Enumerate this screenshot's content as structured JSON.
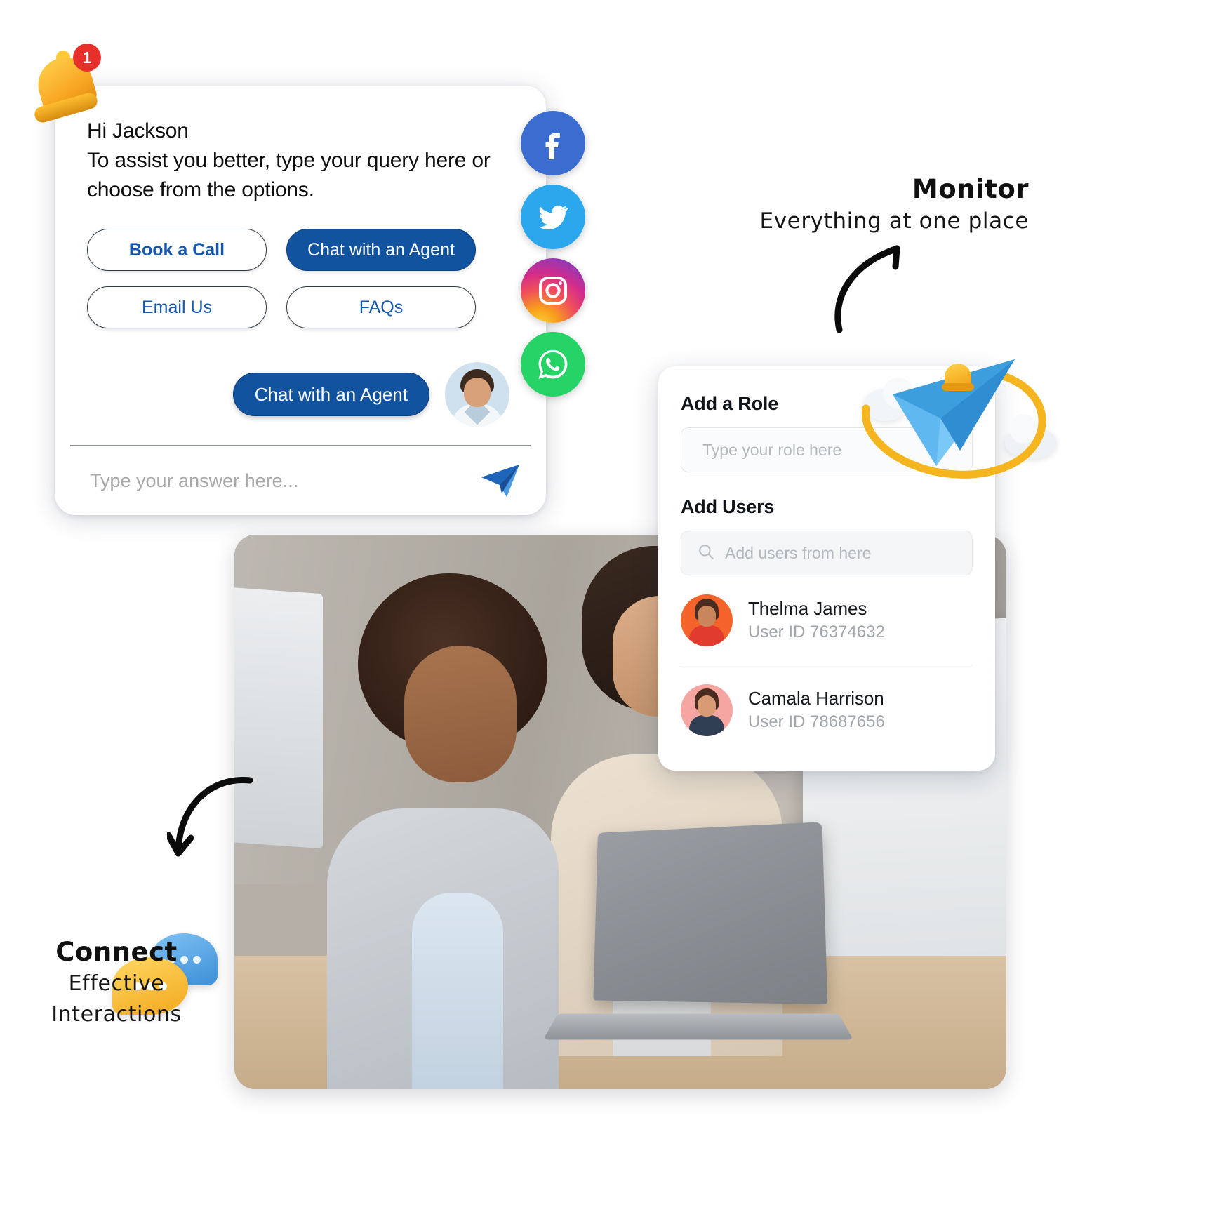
{
  "chat_widget": {
    "notification": {
      "icon": "bell-icon",
      "badge_count": "1"
    },
    "greeting": "Hi Jackson",
    "message_line1": "To assist you better, type your query here or",
    "message_line2": "choose from the options.",
    "options": [
      {
        "label": "Book a Call",
        "style": "outline"
      },
      {
        "label": "Chat with an Agent",
        "style": "filled"
      },
      {
        "label": "Email Us",
        "style": "outline"
      },
      {
        "label": "FAQs",
        "style": "outline"
      }
    ],
    "agent_action": {
      "label": "Chat with an Agent",
      "avatar": "agent-avatar"
    },
    "composer": {
      "placeholder": "Type your answer here...",
      "value": "",
      "send_icon": "send-paper-plane-icon"
    }
  },
  "social_channels": [
    {
      "name": "Facebook",
      "icon": "facebook-icon",
      "color": "#3b6dd0"
    },
    {
      "name": "Twitter",
      "icon": "twitter-icon",
      "color": "#2aa7ed"
    },
    {
      "name": "Instagram",
      "icon": "instagram-icon",
      "color": "#d32c8c"
    },
    {
      "name": "WhatsApp",
      "icon": "whatsapp-icon",
      "color": "#25d366"
    }
  ],
  "annotations": {
    "monitor": {
      "title": "Monitor",
      "subtitle": "Everything at one place"
    },
    "connect": {
      "title": "Connect",
      "subtitle": "Effective Interactions"
    }
  },
  "role_panel": {
    "role_heading": "Add a Role",
    "role_placeholder": "Type your role here",
    "role_value": "",
    "users_heading": "Add Users",
    "users_search_placeholder": "Add users from here",
    "users_search_value": "",
    "search_icon": "search-icon",
    "users": [
      {
        "name": "Thelma James",
        "user_id": "User ID 76374632",
        "avatar_color": "#f4642a"
      },
      {
        "name": "Camala Harrison",
        "user_id": "User ID 78687656",
        "avatar_color": "#f6a6a2"
      }
    ]
  },
  "decor": {
    "paper_plane": "paper-plane-icon",
    "clouds": "cloud-icon",
    "plane_bell": "bell-icon",
    "chat_bubbles": "chat-bubbles-icon",
    "hero_photo": "two-women-looking-at-laptop-photo"
  }
}
